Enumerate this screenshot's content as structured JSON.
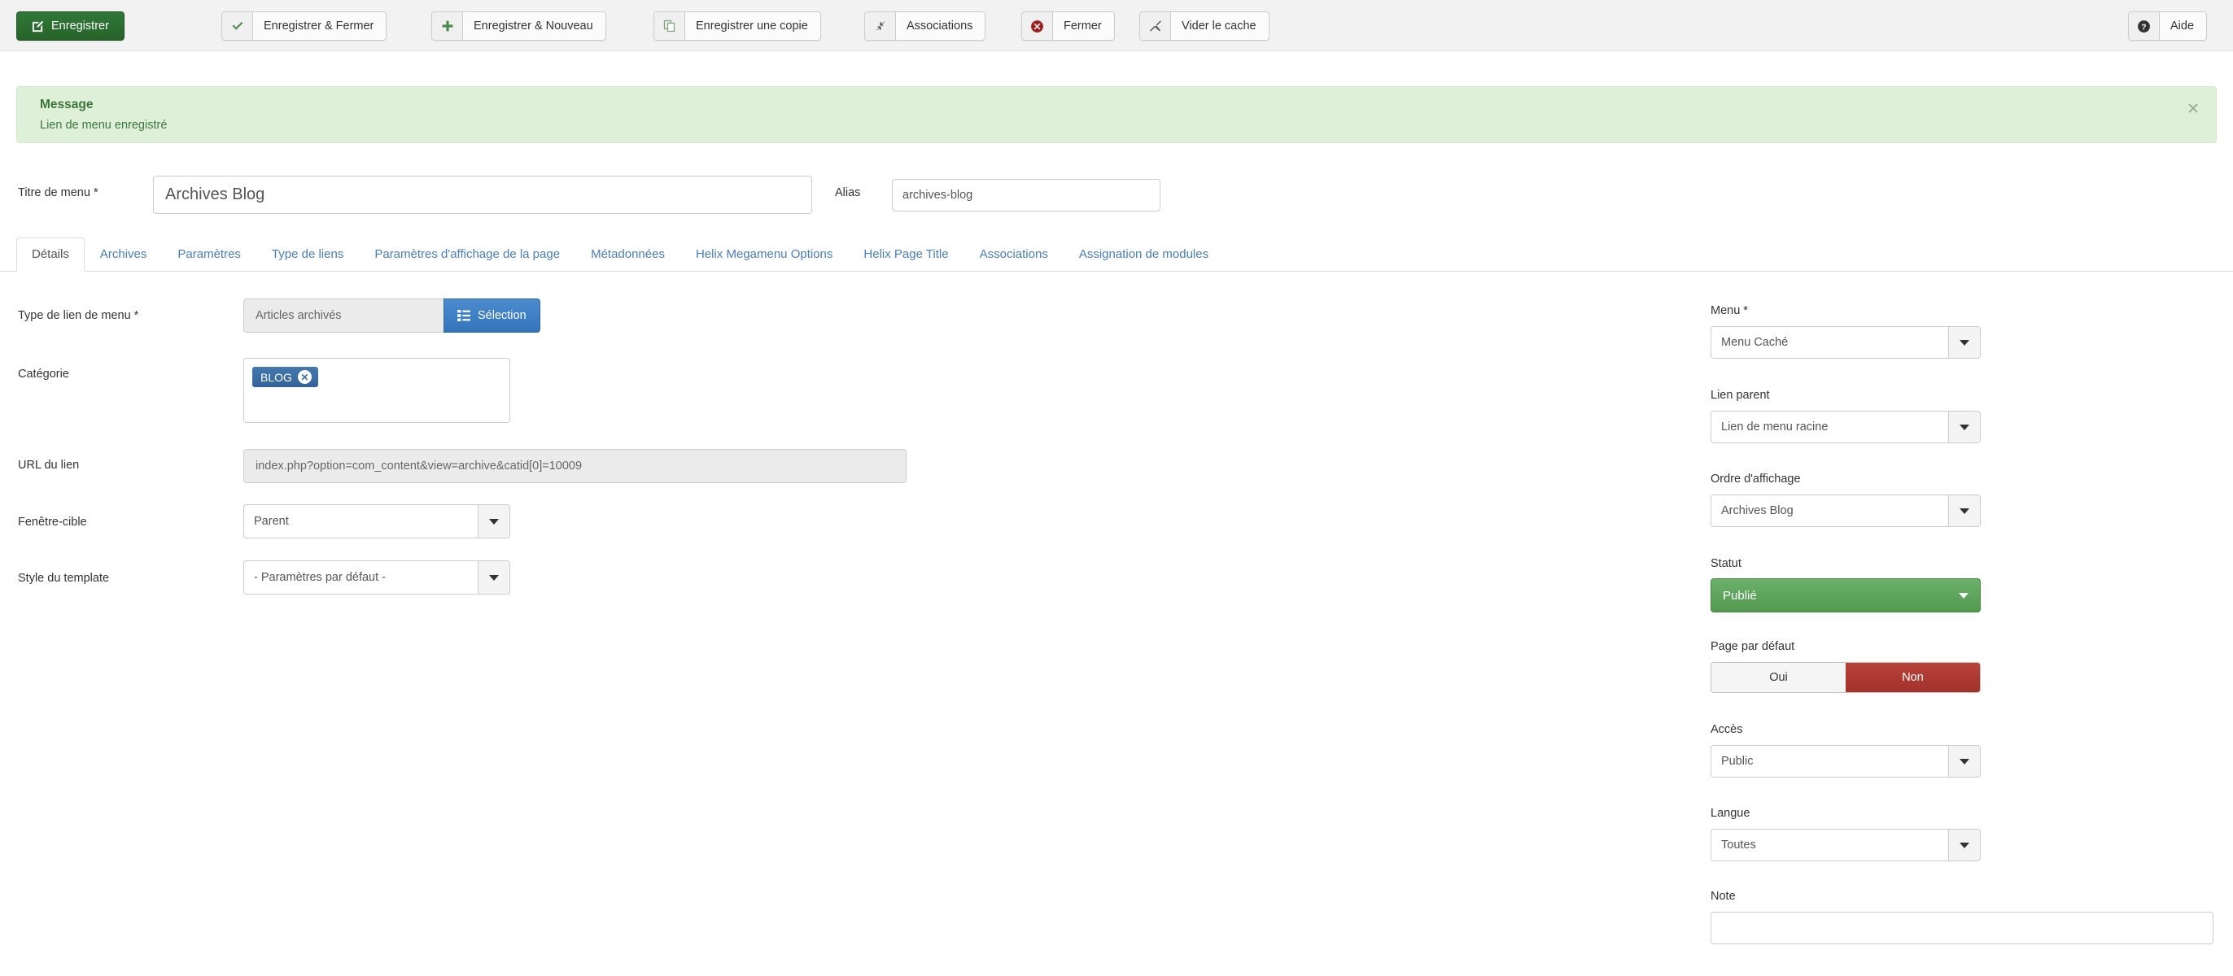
{
  "toolbar": {
    "buttons": [
      {
        "label": "Enregistrer",
        "icon": "pencil-square-icon",
        "style": "primary"
      },
      {
        "label": "Enregistrer & Fermer",
        "icon": "check-icon",
        "style": "split"
      },
      {
        "label": "Enregistrer & Nouveau",
        "icon": "plus-icon",
        "style": "split"
      },
      {
        "label": "Enregistrer une copie",
        "icon": "copy-icon",
        "style": "split"
      },
      {
        "label": "Associations",
        "icon": "arrows-in-icon",
        "style": "split"
      },
      {
        "label": "Fermer",
        "icon": "cancel-circle-icon",
        "style": "split"
      },
      {
        "label": "Vider le cache",
        "icon": "broom-icon",
        "style": "split"
      }
    ],
    "help": {
      "label": "Aide",
      "icon": "question-circle-icon"
    }
  },
  "alert": {
    "title": "Message",
    "text": "Lien de menu enregistré",
    "close_icon": "close-icon",
    "bg_color": "#dff0d8",
    "text_color": "#3c763d"
  },
  "title_row": {
    "menu_title_label": "Titre de menu *",
    "menu_title_value": "Archives Blog",
    "alias_label": "Alias",
    "alias_value": "archives-blog"
  },
  "tabs": [
    {
      "label": "Détails",
      "active": true
    },
    {
      "label": "Archives",
      "active": false
    },
    {
      "label": "Paramètres",
      "active": false
    },
    {
      "label": "Type de liens",
      "active": false
    },
    {
      "label": "Paramètres d'affichage de la page",
      "active": false
    },
    {
      "label": "Métadonnées",
      "active": false
    },
    {
      "label": "Helix Megamenu Options",
      "active": false
    },
    {
      "label": "Helix Page Title",
      "active": false
    },
    {
      "label": "Associations",
      "active": false
    },
    {
      "label": "Assignation de modules",
      "active": false
    }
  ],
  "main": {
    "link_type": {
      "label": "Type de lien de menu *",
      "value": "Articles archivés",
      "select_button": "Sélection",
      "select_icon": "list-icon"
    },
    "category": {
      "label": "Catégorie",
      "tags": [
        {
          "label": "BLOG",
          "remove_icon": "remove-circle-icon"
        }
      ]
    },
    "link_url": {
      "label": "URL du lien",
      "value": "index.php?option=com_content&view=archive&catid[0]=10009"
    },
    "target_window": {
      "label": "Fenêtre-cible",
      "value": "Parent"
    },
    "template_style": {
      "label": "Style du template",
      "value": "- Paramètres par défaut -"
    }
  },
  "sidebar": {
    "menu": {
      "label": "Menu *",
      "value": "Menu Caché"
    },
    "parent": {
      "label": "Lien parent",
      "value": "Lien de menu racine"
    },
    "ordering": {
      "label": "Ordre d'affichage",
      "value": "Archives Blog"
    },
    "status": {
      "label": "Statut",
      "value": "Publié",
      "color": "#5fa35f"
    },
    "default_page": {
      "label": "Page par défaut",
      "yes_label": "Oui",
      "no_label": "Non",
      "selected": "Non",
      "selected_color": "#ad3a32"
    },
    "access": {
      "label": "Accès",
      "value": "Public"
    },
    "language": {
      "label": "Langue",
      "value": "Toutes"
    },
    "note": {
      "label": "Note",
      "value": "",
      "placeholder": ""
    }
  }
}
